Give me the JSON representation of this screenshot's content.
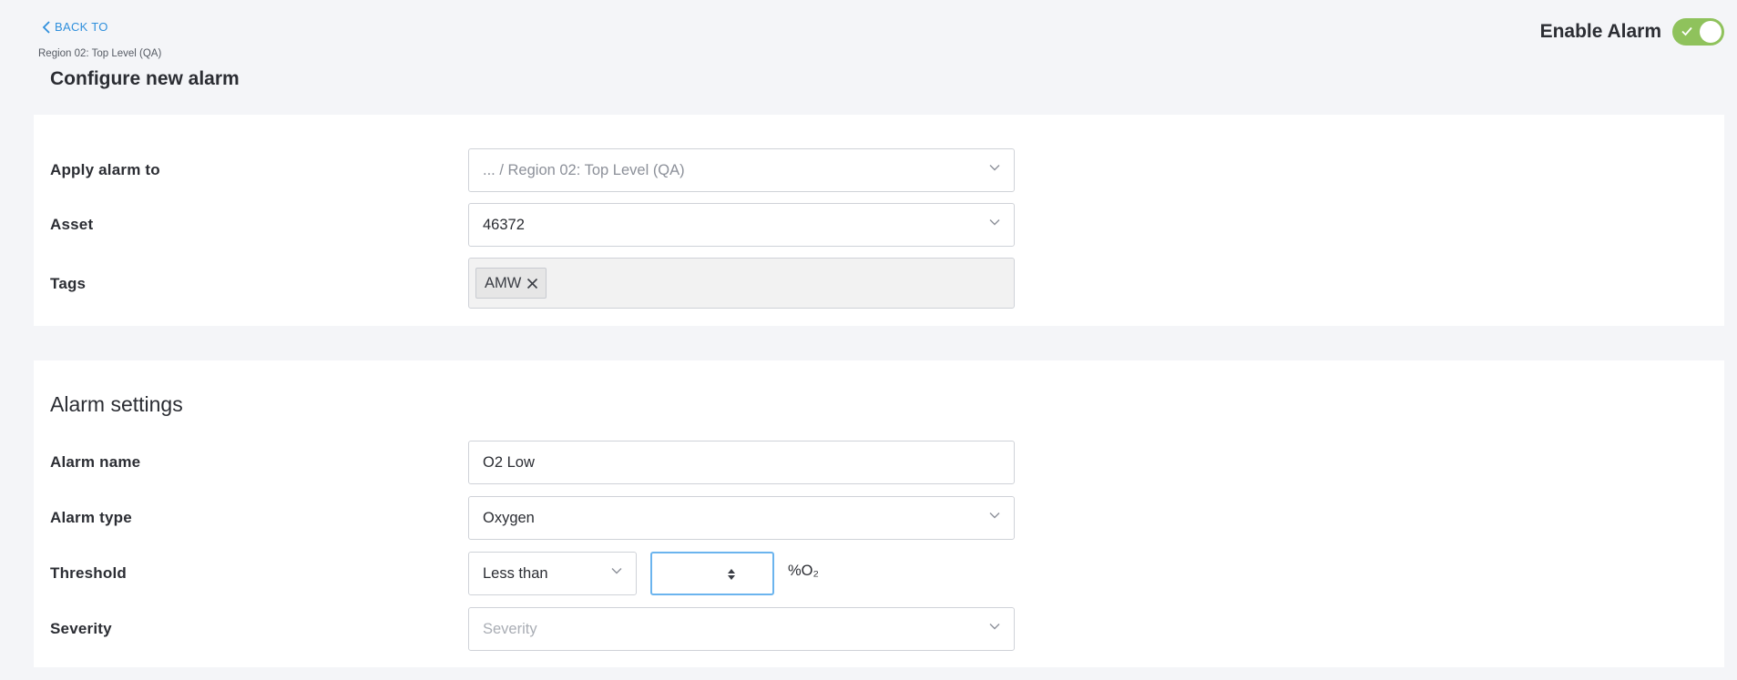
{
  "header": {
    "back_label": "BACK TO",
    "breadcrumb": "Region 02: Top Level (QA)",
    "page_title": "Configure new alarm",
    "enable_label": "Enable Alarm",
    "enable_state": true
  },
  "target": {
    "apply_label": "Apply alarm to",
    "apply_value": "... / Region 02: Top Level (QA)",
    "asset_label": "Asset",
    "asset_value": "46372",
    "tags_label": "Tags",
    "tags": [
      "AMW"
    ]
  },
  "settings": {
    "section_title": "Alarm settings",
    "name_label": "Alarm name",
    "name_value": "O2 Low",
    "type_label": "Alarm type",
    "type_value": "Oxygen",
    "threshold_label": "Threshold",
    "threshold_operator": "Less than",
    "threshold_value": "",
    "threshold_unit": "%O₂",
    "severity_label": "Severity",
    "severity_placeholder": "Severity"
  },
  "colors": {
    "accent": "#2f8fdc",
    "toggle_on": "#8fc25c",
    "focus_border": "#6bb4ee",
    "background": "#f4f5f8"
  },
  "icons": {
    "back": "chevron-left-icon",
    "dropdown": "chevron-down-icon",
    "tag_remove": "close-icon",
    "toggle": "check-icon",
    "spinner": "up-down-arrows-icon"
  }
}
